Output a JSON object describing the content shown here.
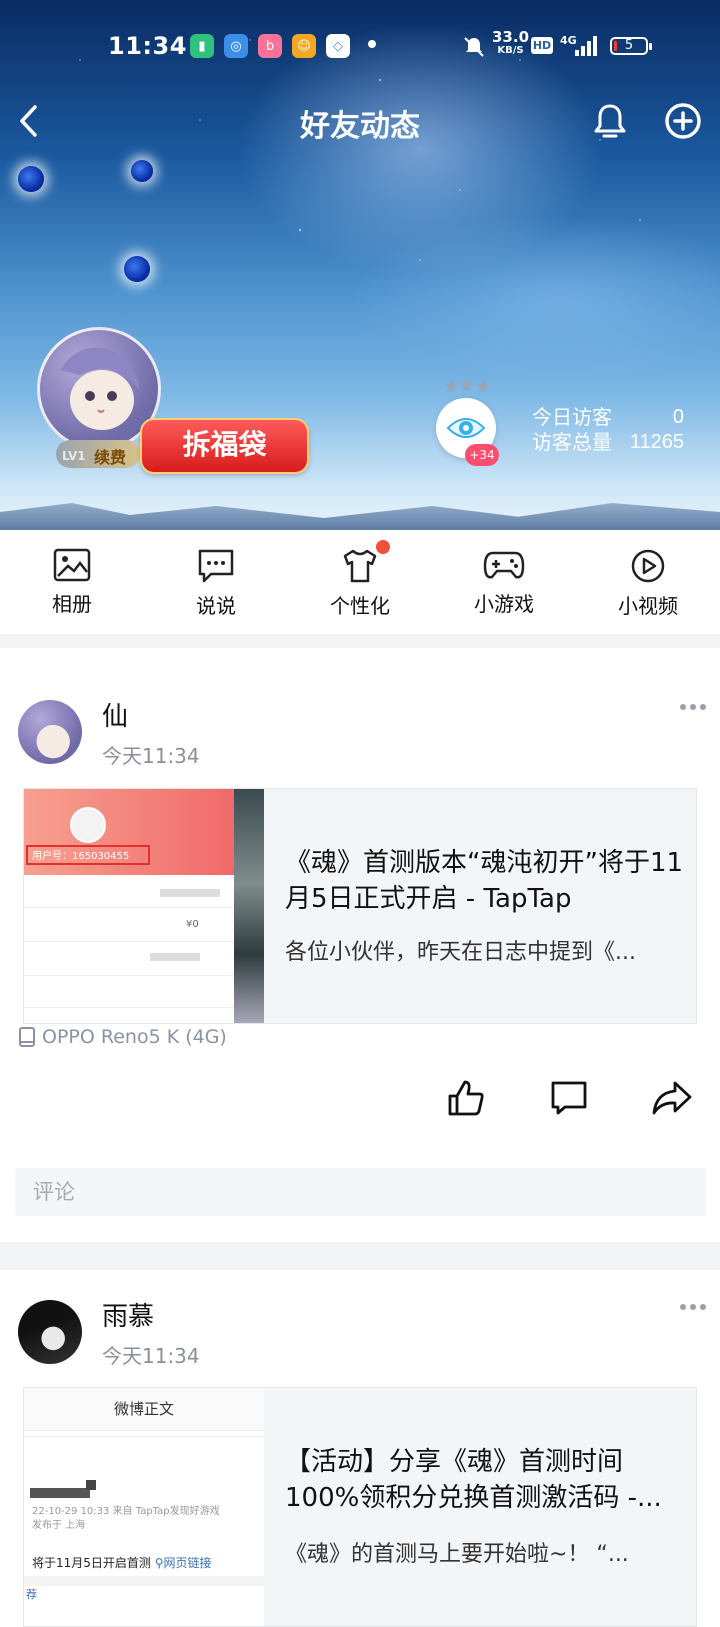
{
  "status_bar": {
    "time": "11:34",
    "app_icons": [
      {
        "name": "battery-saver-icon",
        "glyph": "▮",
        "color": "#2ec27e"
      },
      {
        "name": "browser-icon",
        "glyph": "◎",
        "color": "#3b8fe8"
      },
      {
        "name": "bilibili-icon",
        "glyph": "b",
        "color": "#fb7299"
      },
      {
        "name": "game-app-icon",
        "glyph": "☺",
        "color": "#f5a623"
      },
      {
        "name": "cloud-app-icon",
        "glyph": "◇",
        "color": "#4a90e2"
      }
    ],
    "net_speed": "33.0",
    "net_speed_unit": "KB/S",
    "hd": "HD",
    "network": "4G",
    "battery": "5"
  },
  "nav": {
    "title": "好友动态"
  },
  "profile": {
    "level": "LV1",
    "renew": "续费",
    "lucky_bag": "拆福袋",
    "visitor_badge": "+34",
    "today_label": "今日访客",
    "today_value": "0",
    "total_label": "访客总量",
    "total_value": "11265"
  },
  "toolbar": [
    {
      "label": "相册",
      "icon": "album-icon"
    },
    {
      "label": "说说",
      "icon": "chat-icon"
    },
    {
      "label": "个性化",
      "icon": "shirt-icon"
    },
    {
      "label": "小游戏",
      "icon": "gamepad-icon"
    },
    {
      "label": "小视频",
      "icon": "video-icon"
    }
  ],
  "posts": [
    {
      "name": "仙",
      "time": "今天11:34",
      "card_title": "《魂》首测版本“魂沌初开”将于11月5日正式开启 - TapTap",
      "card_desc": "各位小伙伴，昨天在日志中提到《...",
      "thumb_user_id": "用户号：165030455",
      "thumb_price": "¥0",
      "device": "OPPO Reno5 K (4G)",
      "comment_placeholder": "评论"
    },
    {
      "name": "雨慕",
      "time": "今天11:34",
      "card_title": "【活动】分享《魂》首测时间100%领积分兑换首测激活码 -...",
      "card_desc": "《魂》的首测马上要开始啦~！ “...",
      "thumb_header": "微博正文",
      "thumb_meta": "22-10-29 10:33  来自 TapTap发现好游戏",
      "thumb_location": "发布于 上海",
      "thumb_text": "将于11月5日开启首测",
      "thumb_link": "网页链接",
      "thumb_bottom": "荐"
    }
  ],
  "colors": {
    "accent_red": "#f24e3d",
    "secondary_text": "#8a8f99"
  }
}
